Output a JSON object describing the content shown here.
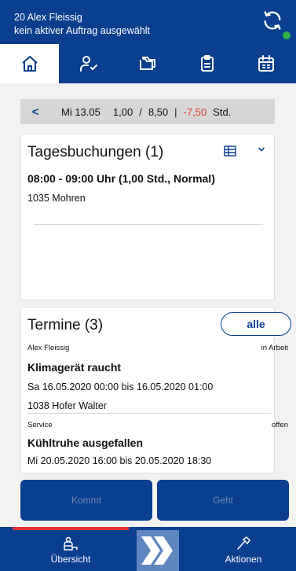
{
  "header": {
    "user_line": "20 Alex Fleissig",
    "status_line": "kein aktiver Auftrag ausgewählt",
    "sync_icon": "sync-icon",
    "online_color": "#2fb24c"
  },
  "tabs": [
    {
      "icon": "home-icon",
      "active": true
    },
    {
      "icon": "user-check-icon",
      "active": false
    },
    {
      "icon": "folder-icon",
      "active": false
    },
    {
      "icon": "clipboard-icon",
      "active": false
    },
    {
      "icon": "calendar-icon",
      "active": false
    }
  ],
  "datebar": {
    "back_icon": "<",
    "date": "Mi 13.05",
    "actual": "1,00",
    "slash": "/",
    "target": "8,50",
    "pipe": "|",
    "diff": "-7,50",
    "unit": "Std."
  },
  "tagesbuchungen": {
    "title": "Tagesbuchungen (1)",
    "entries": [
      {
        "title": "08:00 - 09:00 Uhr (1,00 Std., Normal)",
        "sub": "1035 Mohren"
      }
    ]
  },
  "termine": {
    "title": "Termine (3)",
    "alle_label": "alle",
    "items": [
      {
        "meta_left": "Alex Fleissig",
        "meta_right": "in Arbeit",
        "title": "Klimagerät raucht",
        "time": "Sa 16.05.2020 00:00 bis 16.05.2020 01:00",
        "customer": "1038  Hofer Walter"
      },
      {
        "meta_left": "Service",
        "meta_right": "offen",
        "title": "Kühltruhe ausgefallen",
        "time": "Mi 20.05.2020 16:00 bis 20.05.2020 18:30"
      }
    ]
  },
  "actions": {
    "kommt_label": "Kommt",
    "geht_label": "Geht"
  },
  "bottom_nav": {
    "uebersicht_label": "Übersicht",
    "aktionen_label": "Aktionen"
  },
  "colors": {
    "brand": "#0a3f8f",
    "negative": "#e03b2f",
    "accent_red": "#e0313b"
  }
}
